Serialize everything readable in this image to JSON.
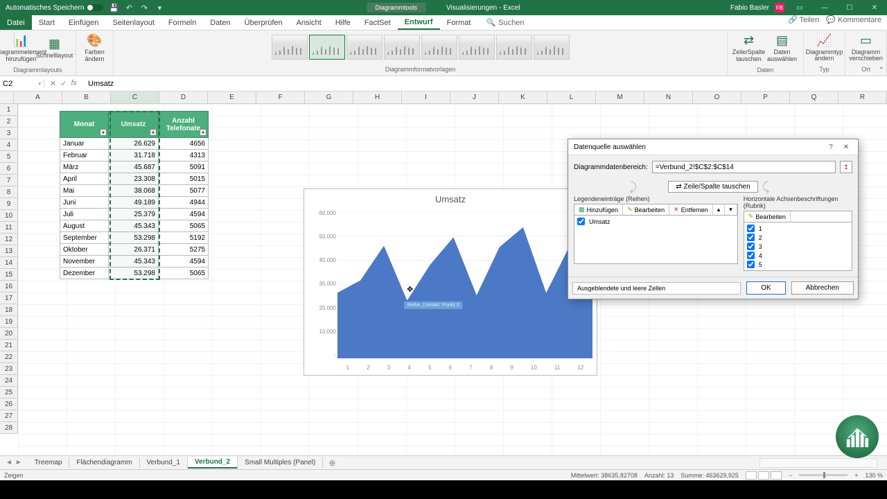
{
  "titlebar": {
    "autosave": "Automatisches Speichern",
    "chart_tools": "Diagrammtools",
    "doc_title": "Visualisierungen - Excel",
    "user": "Fabio Basler",
    "user_initials": "FB"
  },
  "tabs": {
    "file": "Datei",
    "start": "Start",
    "einfuegen": "Einfügen",
    "seitenlayout": "Seitenlayout",
    "formeln": "Formeln",
    "daten": "Daten",
    "ueberpruefen": "Überprüfen",
    "ansicht": "Ansicht",
    "hilfe": "Hilfe",
    "factset": "FactSet",
    "entwurf": "Entwurf",
    "format": "Format",
    "search": "Suchen",
    "teilen": "Teilen",
    "kommentare": "Kommentare"
  },
  "ribbon": {
    "diagrammelement": "Diagrammelement hinzufügen",
    "schnelllayout": "Schnelllayout",
    "layouts_label": "Diagrammlayouts",
    "farben": "Farben ändern",
    "formatvorlagen": "Diagrammformatvorlagen",
    "zeile_spalte": "Zeile/Spalte tauschen",
    "daten_auswaehlen": "Daten auswählen",
    "daten_label": "Daten",
    "diagrammtyp": "Diagrammtyp ändern",
    "typ_label": "Typ",
    "verschieben": "Diagramm verschieben",
    "ort_label": "Ort"
  },
  "formula_bar": {
    "name_box": "C2",
    "formula": "Umsatz"
  },
  "columns": [
    "A",
    "B",
    "C",
    "D",
    "E",
    "F",
    "G",
    "H",
    "I",
    "J",
    "K",
    "L",
    "M",
    "N",
    "O",
    "P",
    "Q",
    "R"
  ],
  "table": {
    "h1": "Monat",
    "h2": "Umsatz",
    "h3": "Anzahl Telefonate",
    "rows": [
      {
        "m": "Januar",
        "u": "26.629",
        "t": "4656"
      },
      {
        "m": "Februar",
        "u": "31.718",
        "t": "4313"
      },
      {
        "m": "März",
        "u": "45.687",
        "t": "5091"
      },
      {
        "m": "April",
        "u": "23.308",
        "t": "5015"
      },
      {
        "m": "Mai",
        "u": "38.068",
        "t": "5077"
      },
      {
        "m": "Juni",
        "u": "49.189",
        "t": "4944"
      },
      {
        "m": "Juli",
        "u": "25.379",
        "t": "4594"
      },
      {
        "m": "August",
        "u": "45.343",
        "t": "5065"
      },
      {
        "m": "September",
        "u": "53.298",
        "t": "5192"
      },
      {
        "m": "Oktober",
        "u": "26.371",
        "t": "5275"
      },
      {
        "m": "November",
        "u": "45.343",
        "t": "4594"
      },
      {
        "m": "Dezember",
        "u": "53.298",
        "t": "5065"
      }
    ]
  },
  "chart_data": {
    "type": "area",
    "title": "Umsatz",
    "categories": [
      "1",
      "2",
      "3",
      "4",
      "5",
      "6",
      "7",
      "8",
      "9",
      "10",
      "11",
      "12"
    ],
    "values": [
      26629,
      31718,
      45687,
      23308,
      38068,
      49189,
      25379,
      45343,
      53298,
      26371,
      45343,
      53298
    ],
    "ylim": [
      0,
      60000
    ],
    "yticks": [
      "60.000",
      "50.000",
      "40.000",
      "30.000",
      "20.000",
      "10.000",
      "-"
    ],
    "tooltip": "Reihe „Umsatz“ Punkt 3"
  },
  "dialog": {
    "title": "Datenquelle auswählen",
    "range_label": "Diagrammdatenbereich:",
    "range_value": "=Verbund_2!$C$2:$C$14",
    "swap": "Zeile/Spalte tauschen",
    "legend_title": "Legendeneinträge (Reihen)",
    "axis_title": "Horizontale Achsenbeschriftungen (Rubrik)",
    "btn_add": "Hinzufügen",
    "btn_edit": "Bearbeiten",
    "btn_remove": "Entfernen",
    "btn_edit2": "Bearbeiten",
    "series_1": "Umsatz",
    "cat_1": "1",
    "cat_2": "2",
    "cat_3": "3",
    "cat_4": "4",
    "cat_5": "5",
    "hidden_cells": "Ausgeblendete und leere Zellen",
    "ok": "OK",
    "cancel": "Abbrechen"
  },
  "sheets": {
    "s1": "Treemap",
    "s2": "Flächendiagramm",
    "s3": "Verbund_1",
    "s4": "Verbund_2",
    "s5": "Small Multiples (Panel)"
  },
  "status": {
    "mode": "Zeigen",
    "avg": "Mittelwert: 38635,82708",
    "count": "Anzahl: 13",
    "sum": "Summe: 463629,925",
    "zoom": "130 %"
  }
}
